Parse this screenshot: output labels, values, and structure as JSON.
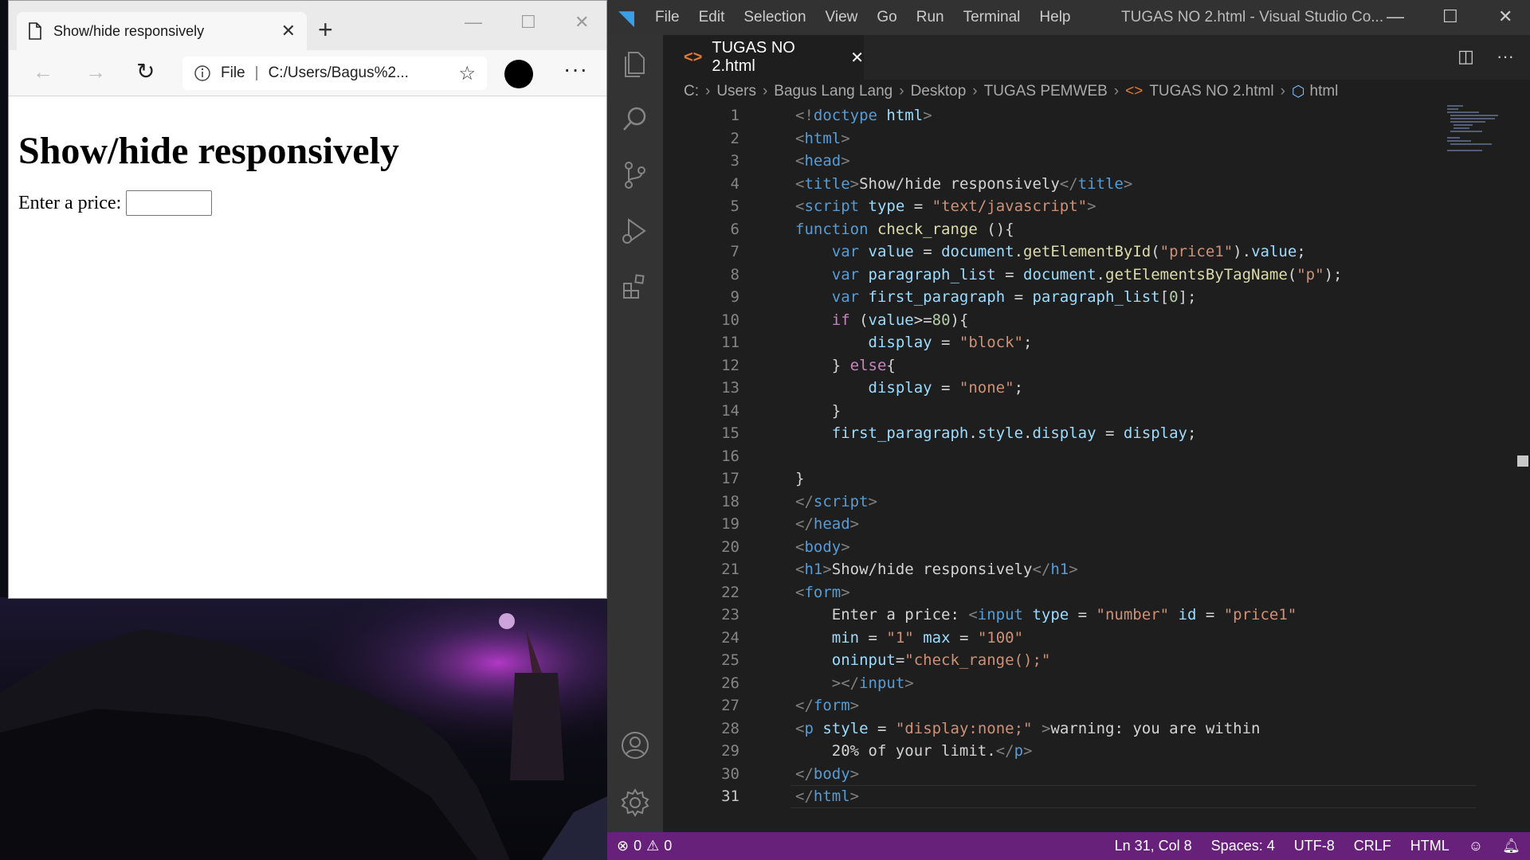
{
  "browser": {
    "tab_title": "Show/hide responsively",
    "address_scheme": "File",
    "address_url": "C:/Users/Bagus%2...",
    "page_heading": "Show/hide responsively",
    "price_label": "Enter a price:",
    "price_value": ""
  },
  "vscode": {
    "menu": [
      "File",
      "Edit",
      "Selection",
      "View",
      "Go",
      "Run",
      "Terminal",
      "Help"
    ],
    "window_title": "TUGAS NO 2.html - Visual Studio Co...",
    "active_tab": "TUGAS NO 2.html",
    "breadcrumb": [
      "C:",
      "Users",
      "Bagus Lang Lang",
      "Desktop",
      "TUGAS PEMWEB",
      "TUGAS NO 2.html",
      "html"
    ],
    "code_lines": [
      {
        "n": "1",
        "segs": [
          [
            "br",
            "<!"
          ],
          [
            "tag",
            "doctype"
          ],
          [
            "txt",
            " "
          ],
          [
            "attr",
            "html"
          ],
          [
            "br",
            ">"
          ]
        ]
      },
      {
        "n": "2",
        "segs": [
          [
            "br",
            "<"
          ],
          [
            "tag",
            "html"
          ],
          [
            "br",
            ">"
          ]
        ]
      },
      {
        "n": "3",
        "segs": [
          [
            "br",
            "<"
          ],
          [
            "tag",
            "head"
          ],
          [
            "br",
            ">"
          ]
        ]
      },
      {
        "n": "4",
        "segs": [
          [
            "br",
            "<"
          ],
          [
            "tag",
            "title"
          ],
          [
            "br",
            ">"
          ],
          [
            "txt",
            "Show/hide responsively"
          ],
          [
            "br",
            "</"
          ],
          [
            "tag",
            "title"
          ],
          [
            "br",
            ">"
          ]
        ]
      },
      {
        "n": "5",
        "segs": [
          [
            "br",
            "<"
          ],
          [
            "tag",
            "script"
          ],
          [
            "txt",
            " "
          ],
          [
            "attr",
            "type"
          ],
          [
            "txt",
            " = "
          ],
          [
            "str",
            "\"text/javascript\""
          ],
          [
            "br",
            ">"
          ]
        ]
      },
      {
        "n": "6",
        "segs": [
          [
            "kw",
            "function"
          ],
          [
            "txt",
            " "
          ],
          [
            "fn",
            "check_range"
          ],
          [
            "txt",
            " (){"
          ]
        ]
      },
      {
        "n": "7",
        "segs": [
          [
            "txt",
            "    "
          ],
          [
            "kw",
            "var"
          ],
          [
            "txt",
            " "
          ],
          [
            "var",
            "value"
          ],
          [
            "txt",
            " = "
          ],
          [
            "var",
            "document"
          ],
          [
            "txt",
            "."
          ],
          [
            "fn",
            "getElementById"
          ],
          [
            "txt",
            "("
          ],
          [
            "str",
            "\"price1\""
          ],
          [
            "txt",
            ")."
          ],
          [
            "var",
            "value"
          ],
          [
            "txt",
            ";"
          ]
        ]
      },
      {
        "n": "8",
        "segs": [
          [
            "txt",
            "    "
          ],
          [
            "kw",
            "var"
          ],
          [
            "txt",
            " "
          ],
          [
            "var",
            "paragraph_list"
          ],
          [
            "txt",
            " = "
          ],
          [
            "var",
            "document"
          ],
          [
            "txt",
            "."
          ],
          [
            "fn",
            "getElementsByTagName"
          ],
          [
            "txt",
            "("
          ],
          [
            "str",
            "\"p\""
          ],
          [
            "txt",
            ");"
          ]
        ]
      },
      {
        "n": "9",
        "segs": [
          [
            "txt",
            "    "
          ],
          [
            "kw",
            "var"
          ],
          [
            "txt",
            " "
          ],
          [
            "var",
            "first_paragraph"
          ],
          [
            "txt",
            " = "
          ],
          [
            "var",
            "paragraph_list"
          ],
          [
            "txt",
            "["
          ],
          [
            "num",
            "0"
          ],
          [
            "txt",
            "];"
          ]
        ]
      },
      {
        "n": "10",
        "segs": [
          [
            "txt",
            "    "
          ],
          [
            "ctrl",
            "if"
          ],
          [
            "txt",
            " ("
          ],
          [
            "var",
            "value"
          ],
          [
            "txt",
            ">="
          ],
          [
            "num",
            "80"
          ],
          [
            "txt",
            "){"
          ]
        ]
      },
      {
        "n": "11",
        "segs": [
          [
            "txt",
            "        "
          ],
          [
            "var",
            "display"
          ],
          [
            "txt",
            " = "
          ],
          [
            "str",
            "\"block\""
          ],
          [
            "txt",
            ";"
          ]
        ]
      },
      {
        "n": "12",
        "segs": [
          [
            "txt",
            "    } "
          ],
          [
            "ctrl",
            "else"
          ],
          [
            "txt",
            "{"
          ]
        ]
      },
      {
        "n": "13",
        "segs": [
          [
            "txt",
            "        "
          ],
          [
            "var",
            "display"
          ],
          [
            "txt",
            " = "
          ],
          [
            "str",
            "\"none\""
          ],
          [
            "txt",
            ";"
          ]
        ]
      },
      {
        "n": "14",
        "segs": [
          [
            "txt",
            "    }"
          ]
        ]
      },
      {
        "n": "15",
        "segs": [
          [
            "txt",
            "    "
          ],
          [
            "var",
            "first_paragraph"
          ],
          [
            "txt",
            "."
          ],
          [
            "var",
            "style"
          ],
          [
            "txt",
            "."
          ],
          [
            "var",
            "display"
          ],
          [
            "txt",
            " = "
          ],
          [
            "var",
            "display"
          ],
          [
            "txt",
            ";"
          ]
        ]
      },
      {
        "n": "16",
        "segs": []
      },
      {
        "n": "17",
        "segs": [
          [
            "txt",
            "}"
          ]
        ]
      },
      {
        "n": "18",
        "segs": [
          [
            "br",
            "</"
          ],
          [
            "tag",
            "script"
          ],
          [
            "br",
            ">"
          ]
        ]
      },
      {
        "n": "19",
        "segs": [
          [
            "br",
            "</"
          ],
          [
            "tag",
            "head"
          ],
          [
            "br",
            ">"
          ]
        ]
      },
      {
        "n": "20",
        "segs": [
          [
            "br",
            "<"
          ],
          [
            "tag",
            "body"
          ],
          [
            "br",
            ">"
          ]
        ]
      },
      {
        "n": "21",
        "segs": [
          [
            "br",
            "<"
          ],
          [
            "tag",
            "h1"
          ],
          [
            "br",
            ">"
          ],
          [
            "txt",
            "Show/hide responsively"
          ],
          [
            "br",
            "</"
          ],
          [
            "tag",
            "h1"
          ],
          [
            "br",
            ">"
          ]
        ]
      },
      {
        "n": "22",
        "segs": [
          [
            "br",
            "<"
          ],
          [
            "tag",
            "form"
          ],
          [
            "br",
            ">"
          ]
        ]
      },
      {
        "n": "23",
        "segs": [
          [
            "txt",
            "    Enter a price: "
          ],
          [
            "br",
            "<"
          ],
          [
            "tag",
            "input"
          ],
          [
            "txt",
            " "
          ],
          [
            "attr",
            "type"
          ],
          [
            "txt",
            " = "
          ],
          [
            "str",
            "\"number\""
          ],
          [
            "txt",
            " "
          ],
          [
            "attr",
            "id"
          ],
          [
            "txt",
            " = "
          ],
          [
            "str",
            "\"price1\""
          ]
        ]
      },
      {
        "n": "24",
        "segs": [
          [
            "txt",
            "    "
          ],
          [
            "attr",
            "min"
          ],
          [
            "txt",
            " = "
          ],
          [
            "str",
            "\"1\""
          ],
          [
            "txt",
            " "
          ],
          [
            "attr",
            "max"
          ],
          [
            "txt",
            " = "
          ],
          [
            "str",
            "\"100\""
          ]
        ]
      },
      {
        "n": "25",
        "segs": [
          [
            "txt",
            "    "
          ],
          [
            "attr",
            "oninput"
          ],
          [
            "txt",
            "="
          ],
          [
            "str",
            "\"check_range();\""
          ]
        ]
      },
      {
        "n": "26",
        "segs": [
          [
            "txt",
            "    "
          ],
          [
            "br",
            "></"
          ],
          [
            "tag",
            "input"
          ],
          [
            "br",
            ">"
          ]
        ]
      },
      {
        "n": "27",
        "segs": [
          [
            "br",
            "</"
          ],
          [
            "tag",
            "form"
          ],
          [
            "br",
            ">"
          ]
        ]
      },
      {
        "n": "28",
        "segs": [
          [
            "br",
            "<"
          ],
          [
            "tag",
            "p"
          ],
          [
            "txt",
            " "
          ],
          [
            "attr",
            "style"
          ],
          [
            "txt",
            " = "
          ],
          [
            "str",
            "\"display:none;\""
          ],
          [
            "txt",
            " "
          ],
          [
            "br",
            ">"
          ],
          [
            "txt",
            "warning: you are within"
          ]
        ]
      },
      {
        "n": "29",
        "segs": [
          [
            "txt",
            "    20% of your limit."
          ],
          [
            "br",
            "</"
          ],
          [
            "tag",
            "p"
          ],
          [
            "br",
            ">"
          ]
        ]
      },
      {
        "n": "30",
        "segs": [
          [
            "br",
            "</"
          ],
          [
            "tag",
            "body"
          ],
          [
            "br",
            ">"
          ]
        ]
      },
      {
        "n": "31",
        "segs": [
          [
            "br",
            "</"
          ],
          [
            "tag",
            "html"
          ],
          [
            "br",
            ">"
          ]
        ]
      }
    ],
    "current_line": "31",
    "status": {
      "errors": "0",
      "warnings": "0",
      "position": "Ln 31, Col 8",
      "spaces": "Spaces: 4",
      "encoding": "UTF-8",
      "eol": "CRLF",
      "language": "HTML"
    }
  },
  "colors": {
    "status_bar": "#68217a",
    "editor_bg": "#1e1e1e",
    "activity_bar": "#333333"
  },
  "icons": [
    "page-icon",
    "back-arrow-icon",
    "forward-arrow-icon",
    "reload-icon",
    "info-icon",
    "favorite-star-icon",
    "more-icon",
    "explorer-icon",
    "search-icon",
    "source-control-icon",
    "run-debug-icon",
    "extensions-icon",
    "account-icon",
    "settings-gear-icon",
    "split-editor-icon",
    "error-icon",
    "warning-icon",
    "feedback-icon",
    "bell-icon"
  ]
}
